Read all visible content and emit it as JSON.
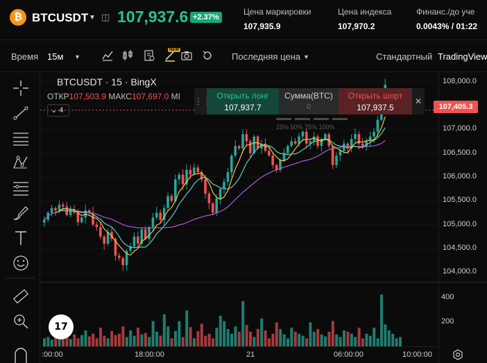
{
  "header": {
    "coin_glyph": "₿",
    "symbol": "BTCUSDT",
    "price": "107,937.6",
    "change": "+2.37%",
    "stats": [
      {
        "label": "Цена маркировки",
        "value": "107,935.9"
      },
      {
        "label": "Цена индекса",
        "value": "107,970.2"
      },
      {
        "label": "Финанс./до уче",
        "value": "0.0043% / 01:22"
      }
    ]
  },
  "toolbar": {
    "time_label": "Время",
    "interval": "15м",
    "new_badge": "NEW",
    "price_type": "Последняя цена",
    "view_standard": "Стандартный",
    "view_tradingview": "TradingView"
  },
  "legend": {
    "title": "BTCUSDT · 15 · BingX",
    "open_label": "ОТКР",
    "open_value": "107,503.9",
    "high_label": "МАКС",
    "high_value": "107,697.0",
    "extra": "МI",
    "collapse_count": "4"
  },
  "trade_panel": {
    "long_label": "Открыть лонг",
    "long_price": "107,937.7",
    "sum_label": "Сумма(BTC)",
    "sum_value": "0",
    "short_label": "Открыть шорт",
    "short_price": "107,937.5",
    "percent_marks": "25%  50%  75%  100%"
  },
  "price_axis": {
    "ticks": [
      "108,000.0",
      "107,500.0",
      "107,000.0",
      "106,500.0",
      "106,000.0",
      "105,500.0",
      "105,000.0",
      "104,500.0",
      "104,000.0"
    ],
    "current": "107,405.3"
  },
  "volume_axis": {
    "ticks": [
      "400",
      "200"
    ]
  },
  "time_axis": {
    "ticks": [
      ":00:00",
      "18:00:00",
      "21",
      "06:00:00",
      "10:00:00"
    ]
  },
  "logo_text": "17",
  "colors": {
    "up": "#26a69a",
    "down": "#ef5350",
    "ma_fast": "#f5c542",
    "ma_mid": "#5fd0c9",
    "ma_slow": "#b45ad6",
    "accent_green": "#27c48d"
  },
  "chart_data": {
    "type": "candlestick",
    "title": "BTCUSDT · 15 · BingX",
    "ylim": [
      103800,
      108200
    ],
    "y_ticks": [
      104000,
      104500,
      105000,
      105500,
      106000,
      106500,
      107000,
      107500,
      108000
    ],
    "closes": [
      105100,
      105250,
      105350,
      105300,
      105420,
      105380,
      105200,
      105320,
      105250,
      105050,
      105150,
      105300,
      105250,
      105000,
      104950,
      104750,
      104600,
      104850,
      104700,
      104350,
      104300,
      104150,
      104450,
      104550,
      104750,
      104600,
      104900,
      104700,
      104950,
      105150,
      105250,
      105100,
      105350,
      105600,
      105500,
      105950,
      106050,
      105850,
      106150,
      106050,
      106200,
      106100,
      105950,
      105650,
      105450,
      105250,
      105550,
      105750,
      105900,
      106100,
      106450,
      106650,
      106600,
      106900,
      106750,
      106500,
      106850,
      106600,
      106700,
      106550,
      106450,
      106250,
      106150,
      106350,
      106500,
      106650,
      106750,
      106700,
      106850,
      106950,
      106700,
      106750,
      106850,
      106650,
      106800,
      106900,
      106650,
      106250,
      106450,
      106550,
      106700,
      106600,
      106800,
      106900,
      106700,
      106650,
      106750,
      106850,
      106950,
      107200,
      107400,
      107938
    ],
    "volume_ylim": [
      0,
      480
    ],
    "volume_ticks": [
      200,
      400
    ],
    "volumes": [
      60,
      70,
      50,
      90,
      80,
      110,
      70,
      55,
      90,
      60,
      85,
      120,
      75,
      95,
      60,
      140,
      80,
      60,
      115,
      85,
      95,
      150,
      70,
      120,
      80,
      140,
      90,
      100,
      70,
      190,
      110,
      80,
      240,
      150,
      60,
      115,
      190,
      70,
      270,
      145,
      60,
      115,
      170,
      80,
      95,
      60,
      140,
      230,
      190,
      130,
      95,
      150,
      110,
      340,
      160,
      110,
      70,
      130,
      210,
      120,
      60,
      95,
      180,
      130,
      90,
      60,
      140,
      110,
      95,
      80,
      60,
      180,
      110,
      130,
      90,
      75,
      110,
      190,
      90,
      70,
      120,
      110,
      95,
      70,
      140,
      60,
      95,
      80,
      140,
      60,
      390,
      165,
      120,
      95,
      60,
      70
    ]
  }
}
